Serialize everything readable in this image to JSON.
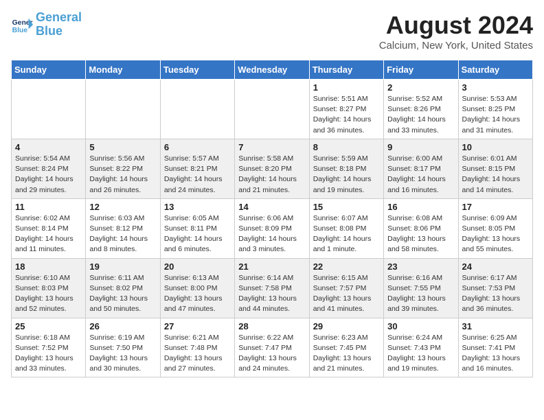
{
  "header": {
    "logo_line1": "General",
    "logo_line2": "Blue",
    "month": "August 2024",
    "location": "Calcium, New York, United States"
  },
  "days_of_week": [
    "Sunday",
    "Monday",
    "Tuesday",
    "Wednesday",
    "Thursday",
    "Friday",
    "Saturday"
  ],
  "weeks": [
    [
      {
        "day": "",
        "info": ""
      },
      {
        "day": "",
        "info": ""
      },
      {
        "day": "",
        "info": ""
      },
      {
        "day": "",
        "info": ""
      },
      {
        "day": "1",
        "info": "Sunrise: 5:51 AM\nSunset: 8:27 PM\nDaylight: 14 hours\nand 36 minutes."
      },
      {
        "day": "2",
        "info": "Sunrise: 5:52 AM\nSunset: 8:26 PM\nDaylight: 14 hours\nand 33 minutes."
      },
      {
        "day": "3",
        "info": "Sunrise: 5:53 AM\nSunset: 8:25 PM\nDaylight: 14 hours\nand 31 minutes."
      }
    ],
    [
      {
        "day": "4",
        "info": "Sunrise: 5:54 AM\nSunset: 8:24 PM\nDaylight: 14 hours\nand 29 minutes."
      },
      {
        "day": "5",
        "info": "Sunrise: 5:56 AM\nSunset: 8:22 PM\nDaylight: 14 hours\nand 26 minutes."
      },
      {
        "day": "6",
        "info": "Sunrise: 5:57 AM\nSunset: 8:21 PM\nDaylight: 14 hours\nand 24 minutes."
      },
      {
        "day": "7",
        "info": "Sunrise: 5:58 AM\nSunset: 8:20 PM\nDaylight: 14 hours\nand 21 minutes."
      },
      {
        "day": "8",
        "info": "Sunrise: 5:59 AM\nSunset: 8:18 PM\nDaylight: 14 hours\nand 19 minutes."
      },
      {
        "day": "9",
        "info": "Sunrise: 6:00 AM\nSunset: 8:17 PM\nDaylight: 14 hours\nand 16 minutes."
      },
      {
        "day": "10",
        "info": "Sunrise: 6:01 AM\nSunset: 8:15 PM\nDaylight: 14 hours\nand 14 minutes."
      }
    ],
    [
      {
        "day": "11",
        "info": "Sunrise: 6:02 AM\nSunset: 8:14 PM\nDaylight: 14 hours\nand 11 minutes."
      },
      {
        "day": "12",
        "info": "Sunrise: 6:03 AM\nSunset: 8:12 PM\nDaylight: 14 hours\nand 8 minutes."
      },
      {
        "day": "13",
        "info": "Sunrise: 6:05 AM\nSunset: 8:11 PM\nDaylight: 14 hours\nand 6 minutes."
      },
      {
        "day": "14",
        "info": "Sunrise: 6:06 AM\nSunset: 8:09 PM\nDaylight: 14 hours\nand 3 minutes."
      },
      {
        "day": "15",
        "info": "Sunrise: 6:07 AM\nSunset: 8:08 PM\nDaylight: 14 hours\nand 1 minute."
      },
      {
        "day": "16",
        "info": "Sunrise: 6:08 AM\nSunset: 8:06 PM\nDaylight: 13 hours\nand 58 minutes."
      },
      {
        "day": "17",
        "info": "Sunrise: 6:09 AM\nSunset: 8:05 PM\nDaylight: 13 hours\nand 55 minutes."
      }
    ],
    [
      {
        "day": "18",
        "info": "Sunrise: 6:10 AM\nSunset: 8:03 PM\nDaylight: 13 hours\nand 52 minutes."
      },
      {
        "day": "19",
        "info": "Sunrise: 6:11 AM\nSunset: 8:02 PM\nDaylight: 13 hours\nand 50 minutes."
      },
      {
        "day": "20",
        "info": "Sunrise: 6:13 AM\nSunset: 8:00 PM\nDaylight: 13 hours\nand 47 minutes."
      },
      {
        "day": "21",
        "info": "Sunrise: 6:14 AM\nSunset: 7:58 PM\nDaylight: 13 hours\nand 44 minutes."
      },
      {
        "day": "22",
        "info": "Sunrise: 6:15 AM\nSunset: 7:57 PM\nDaylight: 13 hours\nand 41 minutes."
      },
      {
        "day": "23",
        "info": "Sunrise: 6:16 AM\nSunset: 7:55 PM\nDaylight: 13 hours\nand 39 minutes."
      },
      {
        "day": "24",
        "info": "Sunrise: 6:17 AM\nSunset: 7:53 PM\nDaylight: 13 hours\nand 36 minutes."
      }
    ],
    [
      {
        "day": "25",
        "info": "Sunrise: 6:18 AM\nSunset: 7:52 PM\nDaylight: 13 hours\nand 33 minutes."
      },
      {
        "day": "26",
        "info": "Sunrise: 6:19 AM\nSunset: 7:50 PM\nDaylight: 13 hours\nand 30 minutes."
      },
      {
        "day": "27",
        "info": "Sunrise: 6:21 AM\nSunset: 7:48 PM\nDaylight: 13 hours\nand 27 minutes."
      },
      {
        "day": "28",
        "info": "Sunrise: 6:22 AM\nSunset: 7:47 PM\nDaylight: 13 hours\nand 24 minutes."
      },
      {
        "day": "29",
        "info": "Sunrise: 6:23 AM\nSunset: 7:45 PM\nDaylight: 13 hours\nand 21 minutes."
      },
      {
        "day": "30",
        "info": "Sunrise: 6:24 AM\nSunset: 7:43 PM\nDaylight: 13 hours\nand 19 minutes."
      },
      {
        "day": "31",
        "info": "Sunrise: 6:25 AM\nSunset: 7:41 PM\nDaylight: 13 hours\nand 16 minutes."
      }
    ]
  ]
}
